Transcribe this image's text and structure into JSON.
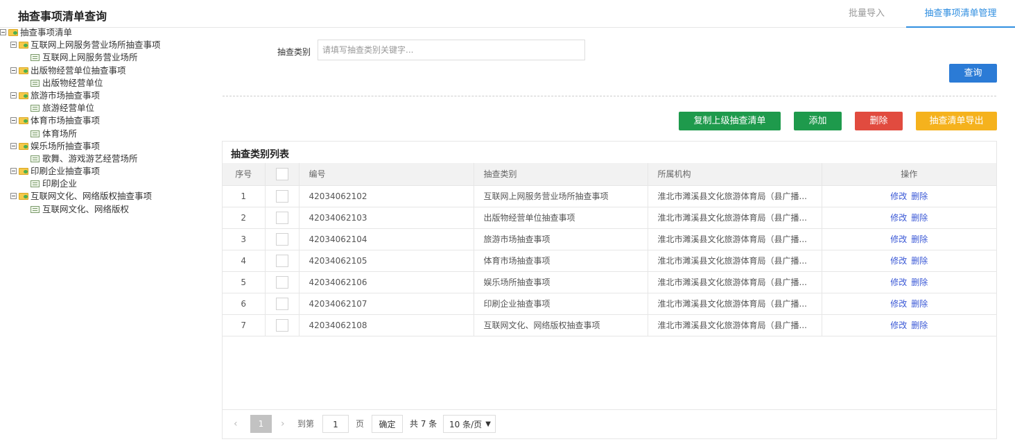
{
  "header": {
    "title": "抽查事项清单查询",
    "tabs": [
      {
        "label": "批量导入"
      },
      {
        "label": "抽查事项清单管理"
      }
    ]
  },
  "tree": {
    "root": "抽查事项清单",
    "groups": [
      {
        "label": "互联网上网服务营业场所抽查事项",
        "child": "互联网上网服务营业场所"
      },
      {
        "label": "出版物经营单位抽查事项",
        "child": "出版物经营单位"
      },
      {
        "label": "旅游市场抽查事项",
        "child": "旅游经营单位"
      },
      {
        "label": "体育市场抽查事项",
        "child": "体育场所"
      },
      {
        "label": "娱乐场所抽查事项",
        "child": "歌舞、游戏游艺经营场所"
      },
      {
        "label": "印刷企业抽查事项",
        "child": "印刷企业"
      },
      {
        "label": "互联网文化、网络版权抽查事项",
        "child": "互联网文化、网络版权"
      }
    ]
  },
  "search": {
    "label": "抽查类别",
    "placeholder": "请填写抽查类别关键字...",
    "value": "",
    "query_button": "查询"
  },
  "actions": {
    "copy": "复制上级抽查清单",
    "add": "添加",
    "delete": "删除",
    "export": "抽查清单导出"
  },
  "table": {
    "title": "抽查类别列表",
    "headers": {
      "no": "序号",
      "code": "编号",
      "type": "抽查类别",
      "org": "所属机构",
      "op": "操作"
    },
    "edit_label": "修改",
    "delete_label": "删除",
    "rows": [
      {
        "no": "1",
        "code": "42034062102",
        "type": "互联网上网服务营业场所抽查事项",
        "org": "淮北市濉溪县文化旅游体育局（县广播..."
      },
      {
        "no": "2",
        "code": "42034062103",
        "type": "出版物经营单位抽查事项",
        "org": "淮北市濉溪县文化旅游体育局（县广播..."
      },
      {
        "no": "3",
        "code": "42034062104",
        "type": "旅游市场抽查事项",
        "org": "淮北市濉溪县文化旅游体育局（县广播..."
      },
      {
        "no": "4",
        "code": "42034062105",
        "type": "体育市场抽查事项",
        "org": "淮北市濉溪县文化旅游体育局（县广播..."
      },
      {
        "no": "5",
        "code": "42034062106",
        "type": "娱乐场所抽查事项",
        "org": "淮北市濉溪县文化旅游体育局（县广播..."
      },
      {
        "no": "6",
        "code": "42034062107",
        "type": "印刷企业抽查事项",
        "org": "淮北市濉溪县文化旅游体育局（县广播..."
      },
      {
        "no": "7",
        "code": "42034062108",
        "type": "互联网文化、网络版权抽查事项",
        "org": "淮北市濉溪县文化旅游体育局（县广播..."
      }
    ]
  },
  "pager": {
    "prev": "‹",
    "current": "1",
    "next": "›",
    "goto_label": "到第",
    "goto_value": "1",
    "page_unit": "页",
    "confirm": "确定",
    "total": "共 7 条",
    "page_size": "10 条/页"
  }
}
